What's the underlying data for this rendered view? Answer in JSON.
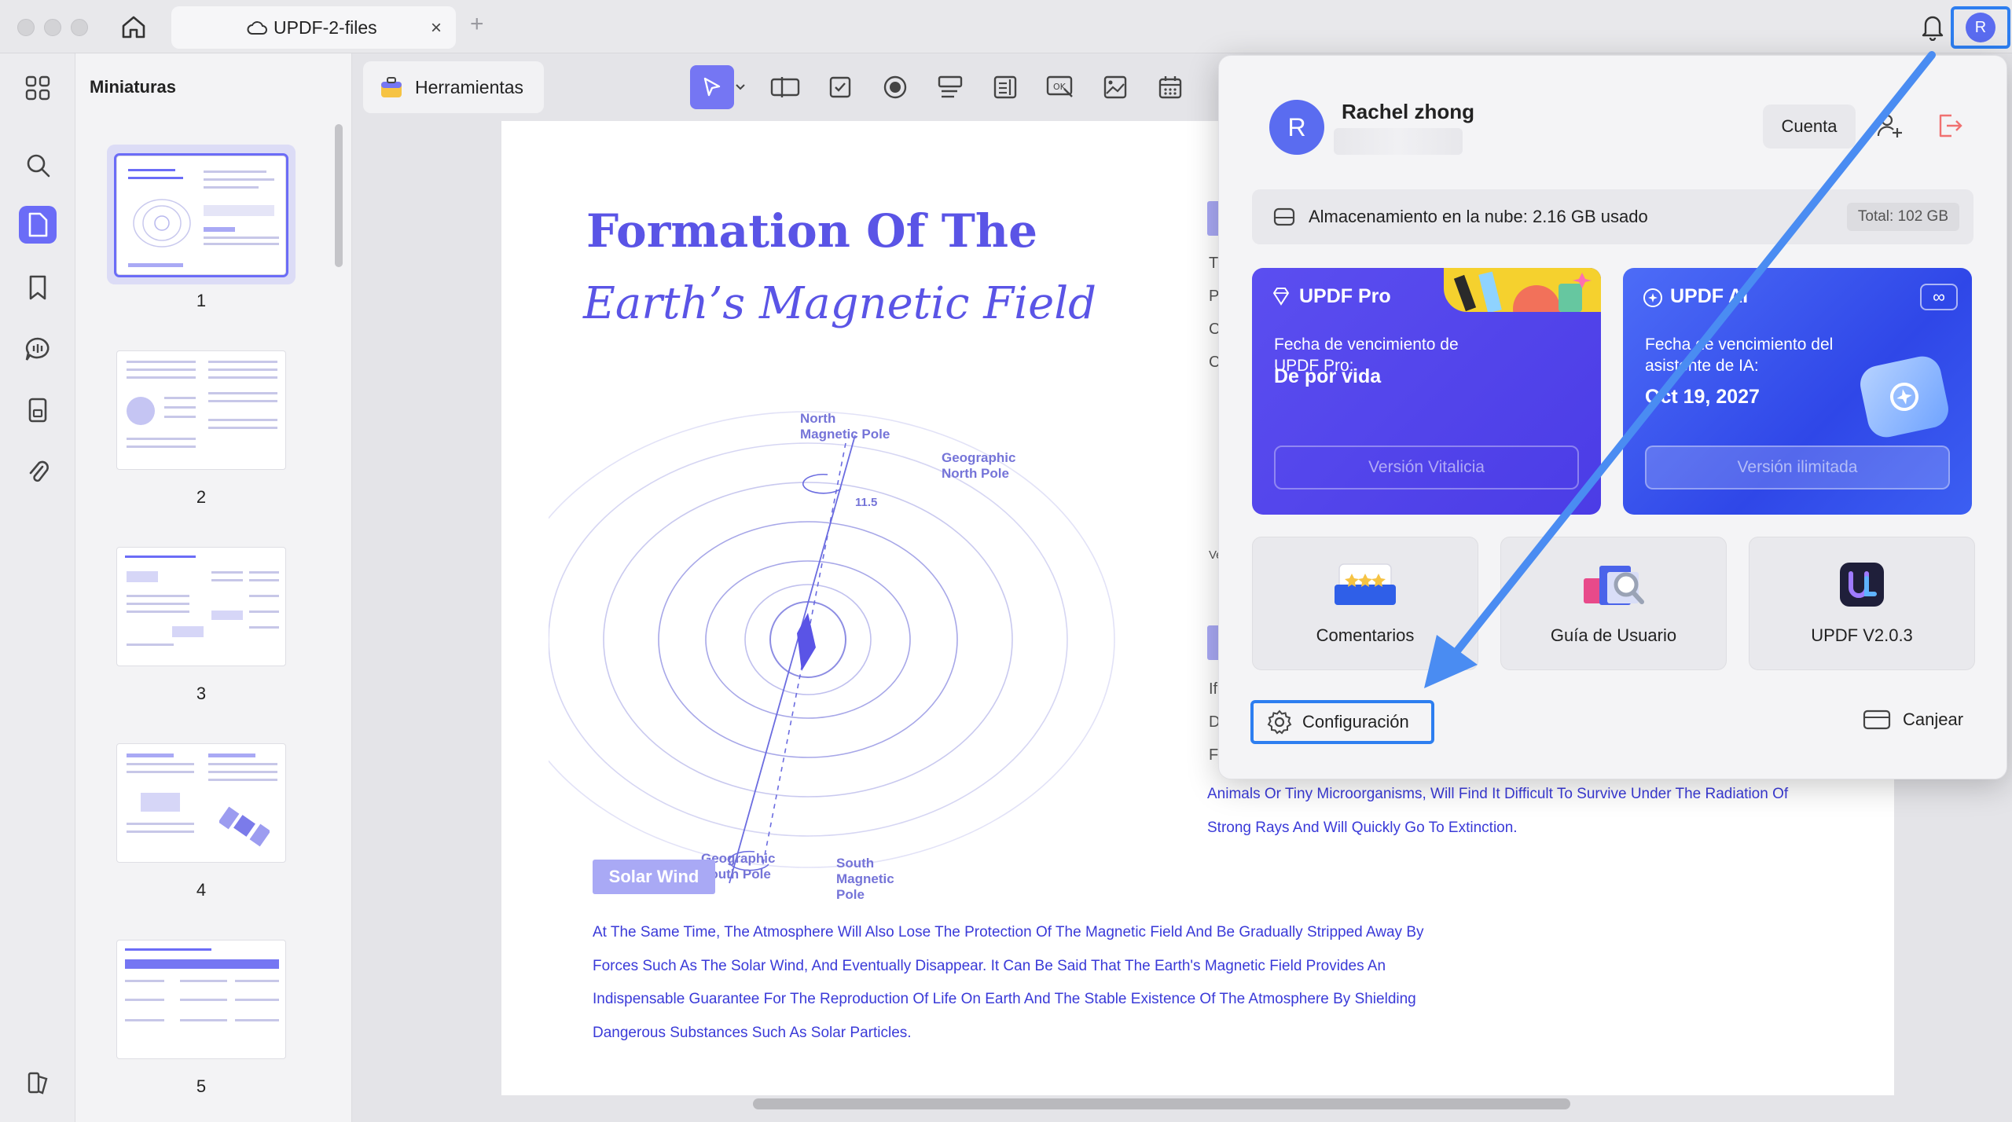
{
  "titlebar": {
    "tab_title": "UPDF-2-files",
    "tab_close": "×",
    "tab_add": "+",
    "avatar_initial": "R"
  },
  "thumbnails": {
    "title": "Miniaturas",
    "pages": [
      "1",
      "2",
      "3",
      "4",
      "5"
    ]
  },
  "toolbar": {
    "tools_label": "Herramientas"
  },
  "document": {
    "title_line1": "Formation Of The",
    "title_line2": "Earth’s Magnetic Field",
    "diagram_labels": {
      "north_magnetic": "North\nMagnetic Pole",
      "geographic_north": "Geographic\nNorth Pole",
      "angle": "11.5",
      "geographic_south": "Geographic\nSouth Pole",
      "south_magnetic": "South\nMagnetic\nPole"
    },
    "section_heading": "Solar Wind",
    "paragraph": "At The Same Time, The Atmosphere Will Also Lose The Protection Of The Magnetic Field And Be Gradually Stripped Away By Forces Such As The Solar Wind, And Eventually Disappear. It Can Be Said That The Earth's Magnetic Field Provides An Indispensable Guarantee For The Reproduction Of Life On Earth And The Stable Existence Of The Atmosphere By Shielding Dangerous Substances Such As Solar Particles.",
    "right_paragraph": "Animals Or Tiny Microorganisms, Will Find It Difficult To Survive Under The Radiation Of Strong Rays And Will Quickly Go To Extinction.",
    "side_letters": [
      "T",
      "P",
      "C",
      "C",
      "Ve",
      "If",
      "D",
      "F"
    ]
  },
  "account": {
    "avatar_initial": "R",
    "name": "Rachel zhong",
    "account_button": "Cuenta",
    "storage_text": "Almacenamiento en la nube: 2.16 GB usado",
    "storage_total": "Total: 102 GB",
    "pro_card": {
      "title": "UPDF Pro",
      "label": "Fecha de vencimiento de UPDF Pro:",
      "value": "De por vida",
      "button": "Versión Vitalicia"
    },
    "ai_card": {
      "title": "UPDF AI",
      "label": "Fecha de vencimiento del asistente de IA:",
      "value": "Oct 19, 2027",
      "button": "Versión ilimitada"
    },
    "tiles": [
      "Comentarios",
      "Guía de Usuario",
      "UPDF V2.0.3"
    ],
    "settings_label": "Configuración",
    "redeem_label": "Canjear"
  },
  "colors": {
    "accent": "#6b6cf7",
    "highlight_blue": "#2d7ef0",
    "doc_text": "#3a3ad8"
  }
}
